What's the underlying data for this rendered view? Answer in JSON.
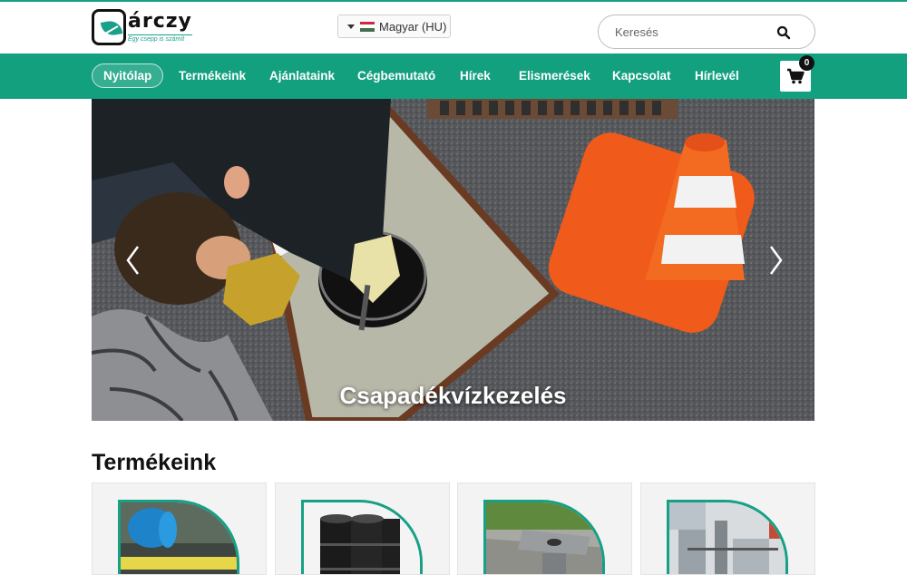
{
  "brand": {
    "name": "árczy",
    "slogan": "Egy csepp is számít",
    "accent_color": "#12a07f"
  },
  "language": {
    "selected": "Magyar (HU)",
    "flag_icon": "hungary-flag-icon"
  },
  "search": {
    "placeholder": "Keresés",
    "icon": "search-icon"
  },
  "nav": {
    "items": [
      {
        "label": "Nyitólap",
        "active": true
      },
      {
        "label": "Termékeink",
        "active": false
      },
      {
        "label": "Ajánlataink",
        "active": false
      },
      {
        "label": "Cégbemutató",
        "active": false
      },
      {
        "label": "Hírek",
        "active": false
      },
      {
        "label": "Elismerések",
        "active": false
      },
      {
        "label": "Kapcsolat",
        "active": false
      },
      {
        "label": "Hírlevél",
        "active": false
      }
    ],
    "cart": {
      "icon": "shopping-cart-icon",
      "count": "0"
    }
  },
  "hero": {
    "caption": "Csapadékvízkezelés",
    "prev_icon": "chevron-left-icon",
    "next_icon": "chevron-right-icon"
  },
  "products": {
    "title": "Termékeink",
    "cards": [
      {
        "image": "blue-barrel-spill-tray"
      },
      {
        "image": "black-drums-on-pallet"
      },
      {
        "image": "steel-drain-on-curb"
      },
      {
        "image": "industrial-equipment"
      }
    ]
  }
}
